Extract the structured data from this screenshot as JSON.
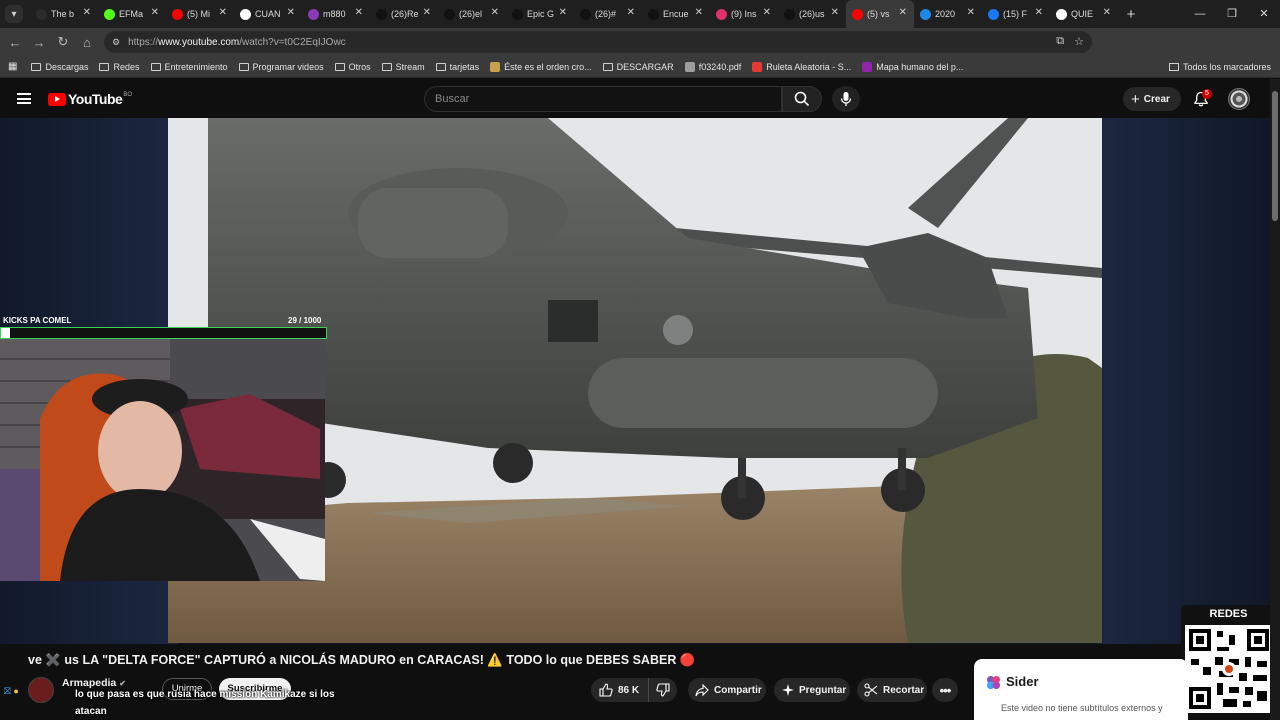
{
  "browser": {
    "tabs": [
      {
        "title": "The b",
        "icon": "tiktok-like-icon",
        "color": "#2b2b2b"
      },
      {
        "title": "EFMa",
        "icon": "kick-icon",
        "color": "#53fc18"
      },
      {
        "title": "(5) Mi",
        "icon": "youtube-icon",
        "color": "#ff0000"
      },
      {
        "title": "CUAN",
        "icon": "google-icon",
        "color": "#ffffff"
      },
      {
        "title": "m880",
        "icon": "instagram-icon",
        "color": "#8a3ab9"
      },
      {
        "title": "(26)Re",
        "icon": "tiktok-icon",
        "color": "#111111"
      },
      {
        "title": "(26)el",
        "icon": "tiktok-icon",
        "color": "#111111"
      },
      {
        "title": "Epic G",
        "icon": "tiktok-icon",
        "color": "#111111"
      },
      {
        "title": "(26)#",
        "icon": "tiktok-icon",
        "color": "#111111"
      },
      {
        "title": "Encue",
        "icon": "tiktok-icon",
        "color": "#111111"
      },
      {
        "title": "(9) Ins",
        "icon": "instagram-icon",
        "color": "#e1306c"
      },
      {
        "title": "(26)us",
        "icon": "tiktok-icon",
        "color": "#111111"
      },
      {
        "title": "(5) vs",
        "icon": "youtube-icon",
        "color": "#ff0000",
        "active": true
      },
      {
        "title": "2020",
        "icon": "site-icon",
        "color": "#1e88e5"
      },
      {
        "title": "(15) F",
        "icon": "facebook-icon",
        "color": "#1877f2"
      },
      {
        "title": "QUIE",
        "icon": "google-icon",
        "color": "#ffffff"
      }
    ],
    "new_tab": "+",
    "url_prefix": "https://",
    "url_host": "www.youtube.com",
    "url_path": "/watch?v=t0C2EqIJOwc",
    "bookmarks": [
      {
        "label": "Descargas",
        "type": "folder"
      },
      {
        "label": "Redes",
        "type": "folder"
      },
      {
        "label": "Entretenimiento",
        "type": "folder"
      },
      {
        "label": "Programar videos",
        "type": "folder"
      },
      {
        "label": "Otros",
        "type": "folder"
      },
      {
        "label": "Stream",
        "type": "folder"
      },
      {
        "label": "tarjetas",
        "type": "folder"
      },
      {
        "label": "Éste es el orden cro...",
        "type": "page",
        "color": "#c8a24a"
      },
      {
        "label": "DESCARGAR",
        "type": "folder"
      },
      {
        "label": "f03240.pdf",
        "type": "page",
        "color": "#9e9e9e"
      },
      {
        "label": "Ruleta Aleatoria - S...",
        "type": "page",
        "color": "#e53935"
      },
      {
        "label": "Mapa humano del p...",
        "type": "page",
        "color": "#8e24aa"
      }
    ],
    "all_bookmarks": "Todos los marcadores"
  },
  "youtube": {
    "logo_text": "YouTube",
    "country_code": "BO",
    "search_placeholder": "Buscar",
    "create_label": "Crear",
    "notifications_count": "5",
    "video": {
      "title": "ve ✖️ us LA \"DELTA FORCE\" CAPTURÓ a NICOLÁS MADURO en CARACAS! ⚠️ TODO lo que DEBES SABER 🔴",
      "channel": "Armapedia",
      "join_label": "Unirme",
      "subscribe_label": "Suscribirme",
      "likes": "86 K",
      "share_label": "Compartir",
      "ask_label": "Preguntar",
      "clip_label": "Recortar",
      "more_label": "•••"
    }
  },
  "overlay": {
    "kicks_label": "KICKS PA COMEL",
    "kicks_count": "29  / 1000",
    "kicks_progress": 0.029,
    "chat_message": "lo que pasa es que rusia hace mission Kamikaze si los atacan",
    "redes_label": "REDES"
  },
  "sider": {
    "name": "Sider",
    "message": "Este video no tiene subtítulos externos y"
  }
}
